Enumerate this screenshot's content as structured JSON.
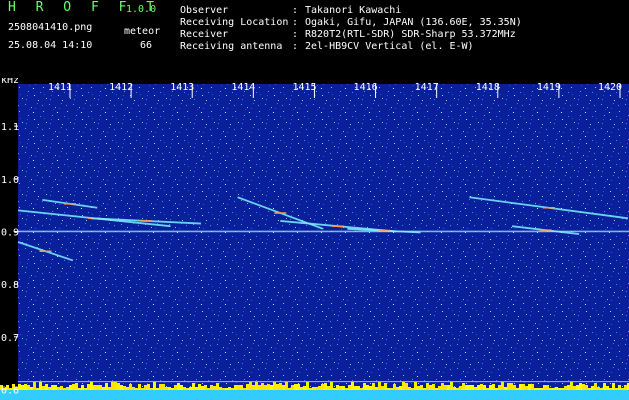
{
  "header": {
    "app_name": "H R O F F T",
    "version": "1.0.0",
    "filename": "2508041410.png",
    "datetime": "25.08.04 14:10",
    "meteor_label": "meteor",
    "meteor_count": "66",
    "info": [
      {
        "key": "Observer",
        "value": "Takanori Kawachi"
      },
      {
        "key": "Receiving Location",
        "value": "Ogaki, Gifu, JAPAN (136.60E, 35.35N)"
      },
      {
        "key": "Receiver",
        "value": "R820T2(RTL-SDR) SDR-Sharp 53.372MHz"
      },
      {
        "key": "Receiving antenna",
        "value": "2el-HB9CV Vertical (el. E-W)"
      }
    ],
    "colors": {
      "brand": "#6cff6c",
      "info": "#ffff44",
      "text": "#ffffff"
    }
  },
  "chart_data": {
    "type": "heatmap",
    "yunit": "kHz",
    "x_ticks": [
      "1411",
      "1412",
      "1413",
      "1414",
      "1415",
      "1416",
      "1417",
      "1418",
      "1419",
      "1420"
    ],
    "y_ticks": [
      "1.1",
      "1.0",
      "0.9",
      "0.8",
      "0.7",
      "0.6"
    ],
    "y_tick_values": [
      1.1,
      1.0,
      0.9,
      0.8,
      0.7,
      0.6
    ],
    "ylim": [
      0.58,
      1.18
    ],
    "background_color": "#0a1f9a",
    "carrier_khz": 0.9,
    "meteor_streaks": [
      {
        "x0": 0.0,
        "x1": 2.5,
        "y0": 0.94,
        "y1": 0.91
      },
      {
        "x0": 0.0,
        "x1": 0.9,
        "y0": 0.88,
        "y1": 0.845
      },
      {
        "x0": 0.4,
        "x1": 1.3,
        "y0": 0.96,
        "y1": 0.945
      },
      {
        "x0": 1.2,
        "x1": 3.0,
        "y0": 0.925,
        "y1": 0.915
      },
      {
        "x0": 3.6,
        "x1": 5.0,
        "y0": 0.965,
        "y1": 0.905
      },
      {
        "x0": 4.3,
        "x1": 6.2,
        "y0": 0.92,
        "y1": 0.9
      },
      {
        "x0": 5.4,
        "x1": 6.6,
        "y0": 0.905,
        "y1": 0.898
      },
      {
        "x0": 7.4,
        "x1": 10.0,
        "y0": 0.965,
        "y1": 0.925
      },
      {
        "x0": 8.1,
        "x1": 9.2,
        "y0": 0.91,
        "y1": 0.895
      }
    ],
    "baseline_colors": [
      "#ffff00",
      "#ffee00",
      "#ffe600"
    ]
  }
}
